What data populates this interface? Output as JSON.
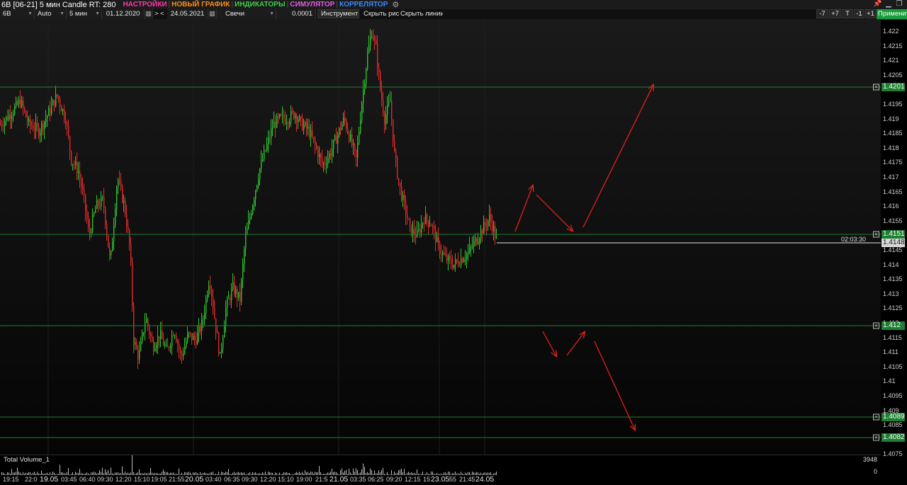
{
  "titlebar": {
    "title": "6B [06-21] 5 мин Candle RT: 280",
    "menus": [
      {
        "label": "НАСТРОЙКИ",
        "color": "#ff3aa5"
      },
      {
        "label": "НОВЫЙ ГРАФИК",
        "color": "#ff8c1a"
      },
      {
        "label": "ИНДИКАТОРЫ",
        "color": "#3fcf4a"
      },
      {
        "label": "СИМУЛЯТОР",
        "color": "#e65ce6"
      },
      {
        "label": "КОРРЕЛЯТОР",
        "color": "#3b8bff"
      }
    ],
    "gear_icon": "gear-icon",
    "window_controls": [
      "pin-icon",
      "minimize-icon",
      "restore-icon"
    ]
  },
  "toolbar": {
    "symbol": "6B",
    "scale": "Auto",
    "timeframe": "5 мин",
    "date_from": "01.12.2020",
    "nav_left": "> <",
    "date_to": "24.05.2021",
    "chart_type": "Свечи",
    "step": "0.0001",
    "tools_button": "Инструменты",
    "hide_drawings": "Скрыть рис.",
    "hide_lines": "Скрыть линии",
    "right_buttons": [
      "-7",
      "+7",
      "T",
      "-1",
      "+1"
    ],
    "apply_button": "Применить"
  },
  "price_axis": {
    "ticks": [
      "1.422",
      "1.4215",
      "1.421",
      "1.4205",
      "1.42",
      "1.4195",
      "1.419",
      "1.4185",
      "1.418",
      "1.4175",
      "1.417",
      "1.4165",
      "1.416",
      "1.4155",
      "1.415",
      "1.4145",
      "1.414",
      "1.4135",
      "1.413",
      "1.4125",
      "1.412",
      "1.4115",
      "1.411",
      "1.4105",
      "1.41",
      "1.4095",
      "1.409",
      "1.4085",
      "1.408",
      "1.4075"
    ],
    "levels": [
      "1.4201",
      "1.4151",
      "1.412",
      "1.4089",
      "1.4082"
    ],
    "current_price": "1.4148",
    "timer": "02:03:30"
  },
  "colors": {
    "up": "#2fc22f",
    "down": "#e02a2a",
    "level_line": "#1e7f32",
    "arrow": "#e0201c"
  },
  "volume": {
    "title": "Total Volume_1",
    "max_label": "3948",
    "zero_label": "0"
  },
  "time_axis": {
    "labels": [
      "19:15",
      "22:0",
      "19.05",
      "03:45",
      "06:40",
      "09:30",
      "12:20",
      "15:10",
      "19:05",
      "21:55",
      "20.05",
      "03:40",
      "06:35",
      "09:30",
      "12:20",
      "15:10",
      "19:00",
      "21:5",
      "21.05",
      "03:35",
      "06:25",
      "09:20",
      "12:15",
      "15",
      "23.05",
      "55",
      "21:45",
      "24.05"
    ],
    "day_labels": [
      "19.05",
      "20.05",
      "21.05",
      "23.05",
      "24.05"
    ]
  }
}
